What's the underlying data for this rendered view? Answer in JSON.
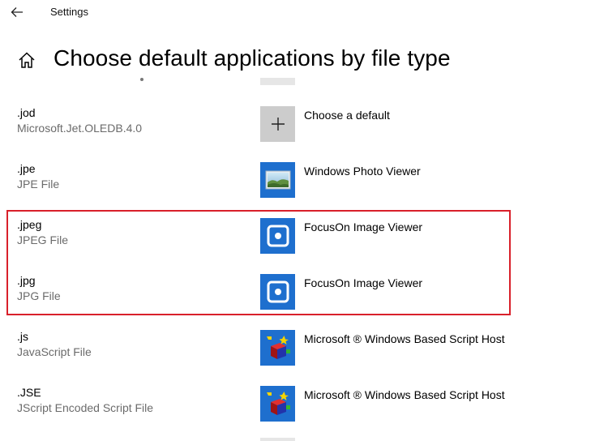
{
  "window": {
    "title": "Settings"
  },
  "page": {
    "title": "Choose default applications by file type"
  },
  "rows": [
    {
      "ext": ".jod",
      "desc": "Microsoft.Jet.OLEDB.4.0",
      "app": "Choose a default",
      "icon": "plus-icon"
    },
    {
      "ext": ".jpe",
      "desc": "JPE File",
      "app": "Windows Photo Viewer",
      "icon": "photo-viewer-icon"
    },
    {
      "ext": ".jpeg",
      "desc": "JPEG File",
      "app": "FocusOn Image Viewer",
      "icon": "focuson-icon"
    },
    {
      "ext": ".jpg",
      "desc": "JPG File",
      "app": "FocusOn Image Viewer",
      "icon": "focuson-icon"
    },
    {
      "ext": ".js",
      "desc": "JavaScript File",
      "app": "Microsoft ® Windows Based Script Host",
      "icon": "script-host-icon"
    },
    {
      "ext": ".JSE",
      "desc": "JScript Encoded Script File",
      "app": "Microsoft ® Windows Based Script Host",
      "icon": "script-host-icon"
    }
  ],
  "colors": {
    "accent": "#1e6fce",
    "highlight": "#d9202a",
    "secondary_text": "#6b6b6b"
  }
}
